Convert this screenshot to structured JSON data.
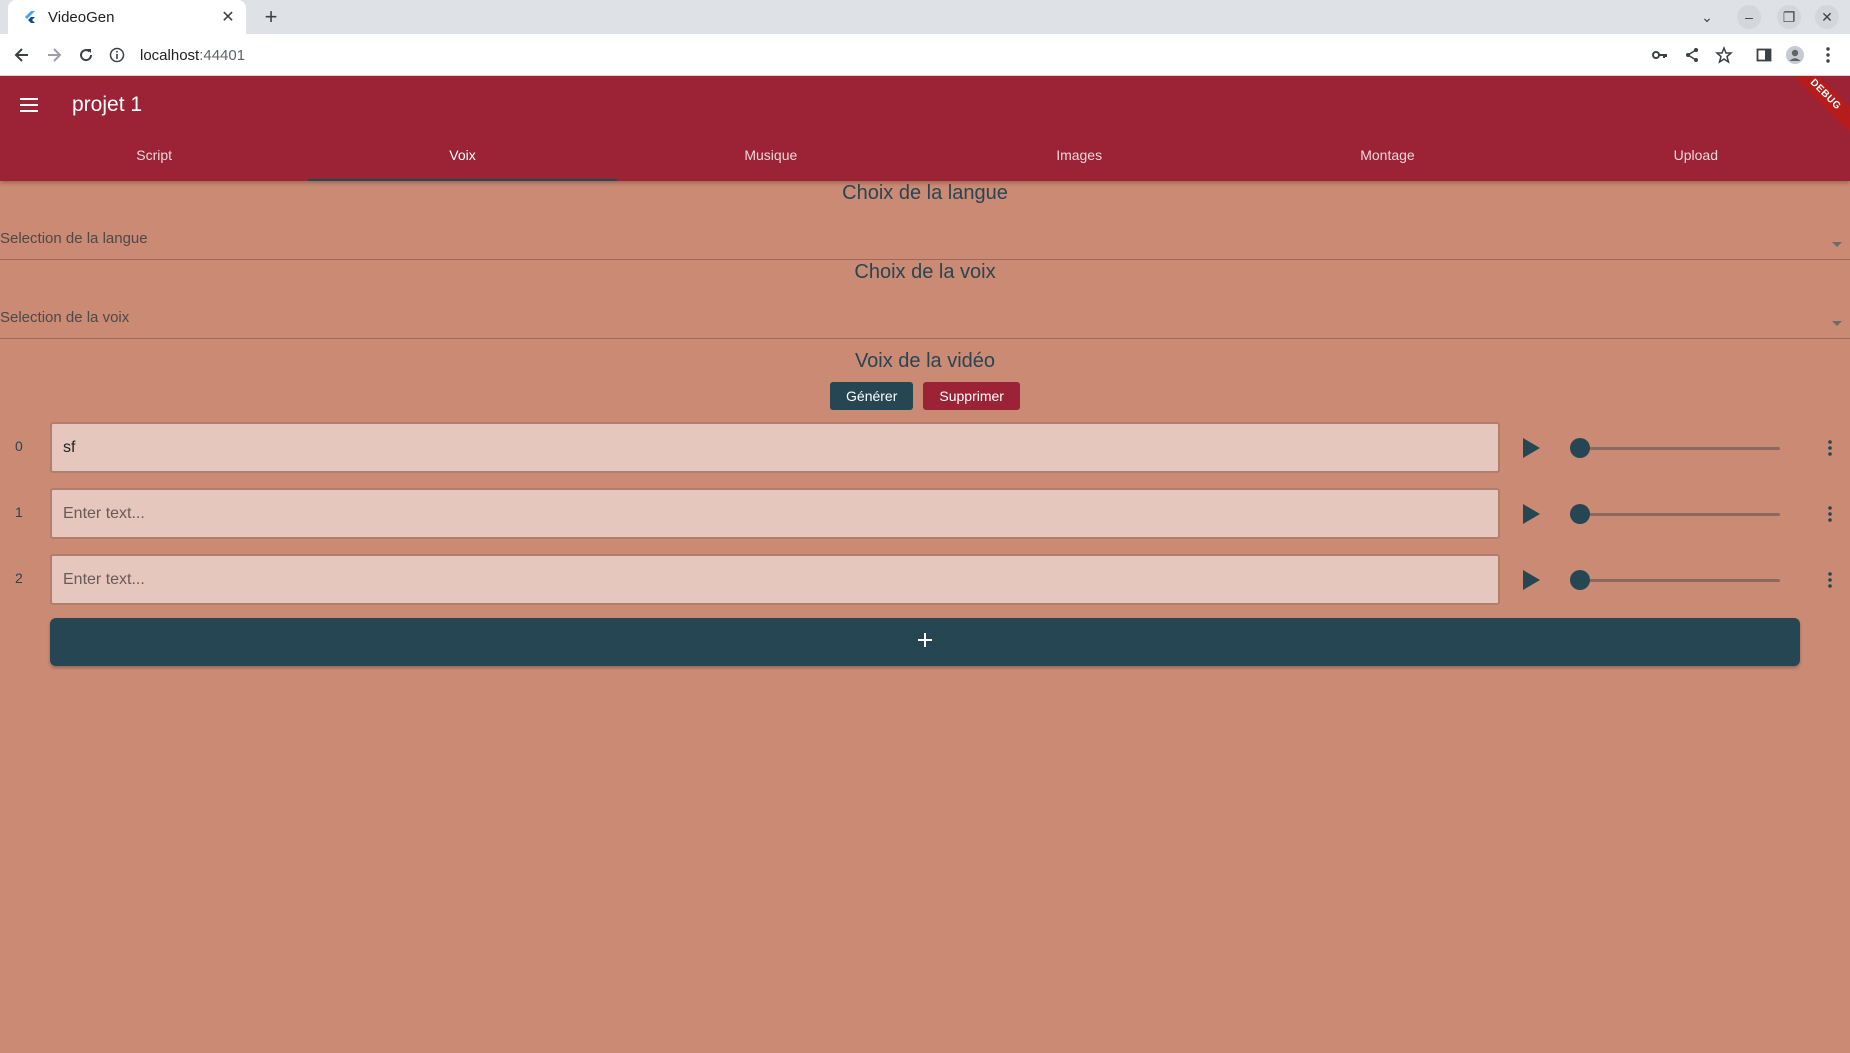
{
  "browser": {
    "tab_title": "VideoGen",
    "url_host": "localhost",
    "url_port": ":44401"
  },
  "appbar": {
    "title": "projet 1",
    "debug_label": "DEBUG",
    "tabs": [
      {
        "label": "Script"
      },
      {
        "label": "Voix"
      },
      {
        "label": "Musique"
      },
      {
        "label": "Images"
      },
      {
        "label": "Montage"
      },
      {
        "label": "Upload"
      }
    ],
    "active_tab": "Voix"
  },
  "language": {
    "title": "Choix de la langue",
    "placeholder": "Selection de la langue"
  },
  "voice": {
    "title": "Choix de la voix",
    "placeholder": "Selection de la voix"
  },
  "video_voice": {
    "title": "Voix de la vidéo",
    "generate_label": "Générer",
    "delete_label": "Supprimer",
    "rows": [
      {
        "index": "0",
        "text": "sf",
        "placeholder": "Enter text...",
        "progress": 0
      },
      {
        "index": "1",
        "text": "",
        "placeholder": "Enter text...",
        "progress": 0
      },
      {
        "index": "2",
        "text": "",
        "placeholder": "Enter text...",
        "progress": 0
      }
    ],
    "add_icon": "plus-icon"
  },
  "colors": {
    "primary": "#9b2335",
    "secondary": "#264653",
    "background": "#cb8a74",
    "field": "#e5c7be"
  }
}
